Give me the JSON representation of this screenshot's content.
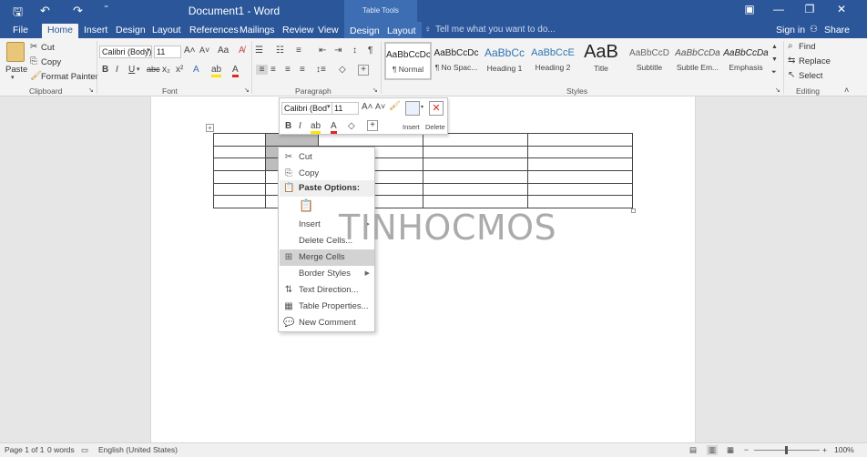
{
  "titlebar": {
    "doc_title": "Document1 - Word",
    "context_tab": "Table Tools",
    "qa_save": "🖫",
    "qa_undo": "↶",
    "qa_redo": "↷",
    "qa_more": "⁼",
    "win_restore_ribbon": "▣",
    "win_min": "—",
    "win_max": "❐",
    "win_close": "✕"
  },
  "tabs": {
    "file": "File",
    "home": "Home",
    "insert": "Insert",
    "design": "Design",
    "layout": "Layout",
    "references": "References",
    "mailings": "Mailings",
    "review": "Review",
    "view": "View",
    "table_design": "Design",
    "table_layout": "Layout",
    "tellme": "Tell me what you want to do...",
    "signin": "Sign in",
    "share": "Share"
  },
  "ribbon": {
    "clipboard": {
      "paste": "Paste",
      "cut": "Cut",
      "copy": "Copy",
      "format_painter": "Format Painter",
      "label": "Clipboard"
    },
    "font": {
      "name": "Calibri (Body)",
      "size": "11",
      "label": "Font"
    },
    "paragraph": {
      "label": "Paragraph"
    },
    "styles": {
      "label": "Styles",
      "items": [
        {
          "preview": "AaBbCcDc",
          "name": "¶ Normal"
        },
        {
          "preview": "AaBbCcDc",
          "name": "¶ No Spac..."
        },
        {
          "preview": "AaBbCc",
          "name": "Heading 1"
        },
        {
          "preview": "AaBbCcE",
          "name": "Heading 2"
        },
        {
          "preview": "AaB",
          "name": "Title"
        },
        {
          "preview": "AaBbCcD",
          "name": "Subtitle"
        },
        {
          "preview": "AaBbCcDa",
          "name": "Subtle Em..."
        },
        {
          "preview": "AaBbCcDa",
          "name": "Emphasis"
        }
      ]
    },
    "editing": {
      "find": "Find",
      "replace": "Replace",
      "select": "Select",
      "label": "Editing"
    }
  },
  "minitoolbar": {
    "font": "Calibri (Bod",
    "size": "11",
    "insert": "Insert",
    "delete": "Delete"
  },
  "contextmenu": {
    "cut": "Cut",
    "copy": "Copy",
    "paste_options": "Paste Options:",
    "insert": "Insert",
    "delete_cells": "Delete Cells...",
    "merge_cells": "Merge Cells",
    "border_styles": "Border Styles",
    "text_direction": "Text Direction...",
    "table_properties": "Table Properties...",
    "new_comment": "New Comment"
  },
  "watermark": "TINHOCMOS",
  "statusbar": {
    "page": "Page 1 of 1",
    "words": "0 words",
    "language": "English (United States)",
    "zoom": "100%"
  },
  "colors": {
    "accent": "#2b579a",
    "highlight_selected": "#d3d3d3"
  }
}
